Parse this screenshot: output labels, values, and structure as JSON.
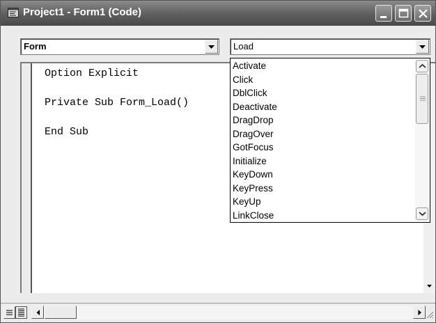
{
  "window": {
    "title": "Project1 - Form1 (Code)",
    "icon": "code-window-icon",
    "controls": [
      "minimize-icon",
      "maximize-icon",
      "close-icon"
    ]
  },
  "object_combo": {
    "value": "Form"
  },
  "procedure_combo": {
    "value": "Load",
    "expanded": true
  },
  "code": {
    "lines": [
      "Option Explicit",
      "Private Sub Form_Load()",
      "End Sub"
    ]
  },
  "event_list": {
    "items": [
      "Activate",
      "Click",
      "DblClick",
      "Deactivate",
      "DragDrop",
      "DragOver",
      "GotFocus",
      "Initialize",
      "KeyDown",
      "KeyPress",
      "KeyUp",
      "LinkClose"
    ],
    "scroll_position": 0
  },
  "colors": {
    "titlebar": "#5e5e5e",
    "window_bg": "#ececec",
    "pane_bg": "#ffffff"
  }
}
